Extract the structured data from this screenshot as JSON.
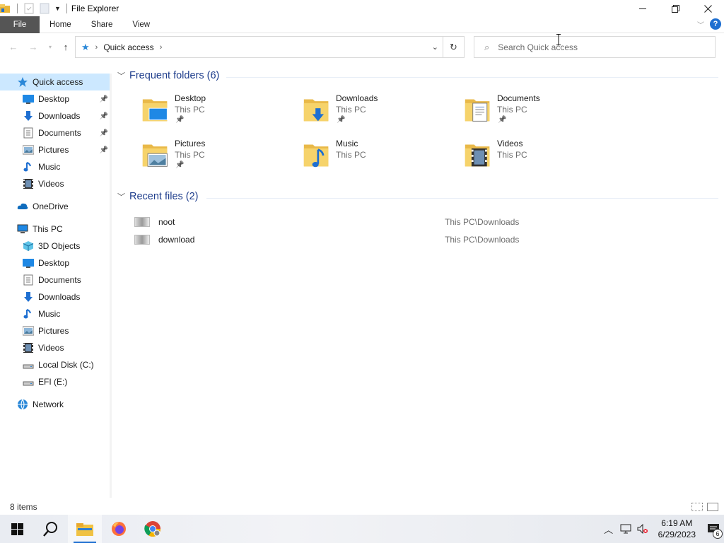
{
  "window": {
    "title": "File Explorer",
    "controls": [
      "minimize",
      "maximize",
      "close"
    ]
  },
  "ribbon": {
    "tabs": [
      {
        "label": "File",
        "active": true
      },
      {
        "label": "Home"
      },
      {
        "label": "Share"
      },
      {
        "label": "View"
      }
    ]
  },
  "address": {
    "crumbs": [
      "Quick access"
    ],
    "search_placeholder": "Search Quick access"
  },
  "sidebar": {
    "items": [
      {
        "label": "Quick access",
        "icon": "star-icon",
        "selected": true,
        "indent": 0
      },
      {
        "label": "Desktop",
        "icon": "desktop-icon",
        "pinned": true,
        "indent": 1
      },
      {
        "label": "Downloads",
        "icon": "downloads-icon",
        "pinned": true,
        "indent": 1
      },
      {
        "label": "Documents",
        "icon": "documents-icon",
        "pinned": true,
        "indent": 1
      },
      {
        "label": "Pictures",
        "icon": "pictures-icon",
        "pinned": true,
        "indent": 1
      },
      {
        "label": "Music",
        "icon": "music-icon",
        "indent": 1
      },
      {
        "label": "Videos",
        "icon": "videos-icon",
        "indent": 1
      },
      {
        "label": "OneDrive",
        "icon": "cloud-icon",
        "indent": 0
      },
      {
        "label": "This PC",
        "icon": "computer-icon",
        "indent": 0
      },
      {
        "label": "3D Objects",
        "icon": "cube-icon",
        "indent": 1
      },
      {
        "label": "Desktop",
        "icon": "desktop-icon",
        "indent": 1
      },
      {
        "label": "Documents",
        "icon": "documents-icon",
        "indent": 1
      },
      {
        "label": "Downloads",
        "icon": "downloads-icon",
        "indent": 1
      },
      {
        "label": "Music",
        "icon": "music-icon",
        "indent": 1
      },
      {
        "label": "Pictures",
        "icon": "pictures-icon",
        "indent": 1
      },
      {
        "label": "Videos",
        "icon": "videos-icon",
        "indent": 1
      },
      {
        "label": "Local Disk (C:)",
        "icon": "drive-icon",
        "indent": 1
      },
      {
        "label": "EFI (E:)",
        "icon": "drive-icon",
        "indent": 1
      },
      {
        "label": "Network",
        "icon": "network-icon",
        "indent": 0
      }
    ]
  },
  "frequent": {
    "header": "Frequent folders (6)",
    "folders": [
      {
        "name": "Desktop",
        "location": "This PC",
        "pinned": true,
        "overlay": "desktop"
      },
      {
        "name": "Downloads",
        "location": "This PC",
        "pinned": true,
        "overlay": "downloads"
      },
      {
        "name": "Documents",
        "location": "This PC",
        "pinned": true,
        "overlay": "documents"
      },
      {
        "name": "Pictures",
        "location": "This PC",
        "pinned": true,
        "overlay": "pictures"
      },
      {
        "name": "Music",
        "location": "This PC",
        "pinned": false,
        "overlay": "music"
      },
      {
        "name": "Videos",
        "location": "This PC",
        "pinned": false,
        "overlay": "videos"
      }
    ]
  },
  "recent": {
    "header": "Recent files (2)",
    "files": [
      {
        "name": "noot",
        "path": "This PC\\Downloads"
      },
      {
        "name": "download",
        "path": "This PC\\Downloads"
      }
    ]
  },
  "status": {
    "item_count": "8 items"
  },
  "taskbar": {
    "apps": [
      "start-icon",
      "search-icon",
      "file-explorer-icon",
      "firefox-icon",
      "chrome-icon"
    ],
    "time": "6:19 AM",
    "date": "6/29/2023",
    "notifications": "6"
  },
  "colors": {
    "accent": "#1e6fd1",
    "selected_bg": "#cce8ff",
    "group_header": "#1e3d8c",
    "file_tab": "#555555"
  }
}
